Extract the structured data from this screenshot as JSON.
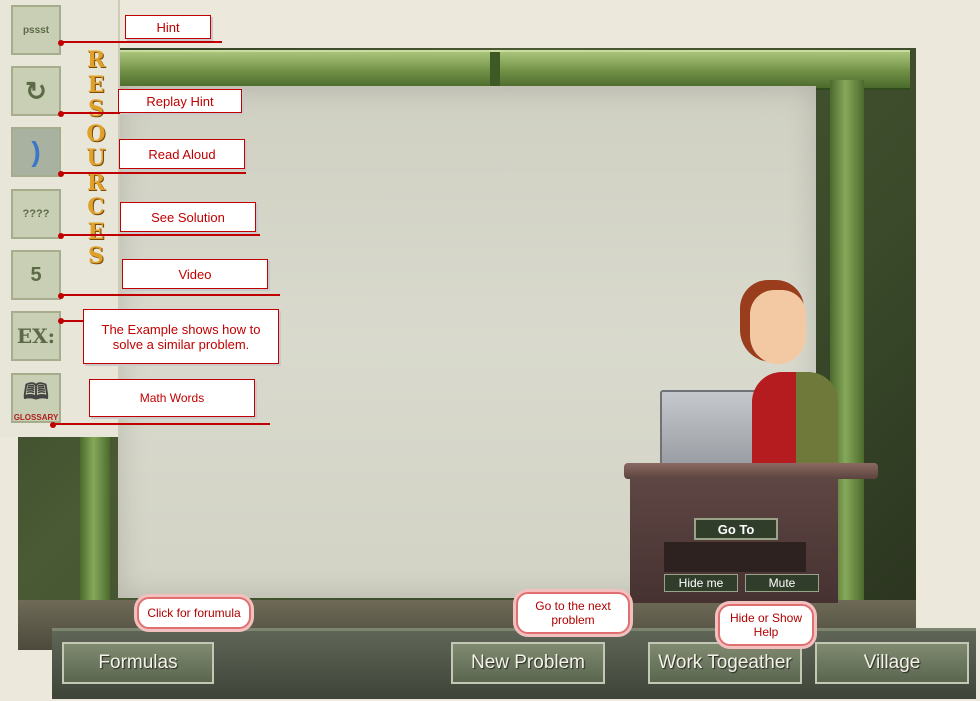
{
  "sidebar": {
    "title": "RESOURCES",
    "tiles": [
      {
        "name": "hint-tile",
        "glyph": "pssst"
      },
      {
        "name": "replay-hint-tile",
        "glyph": "↻"
      },
      {
        "name": "read-aloud-tile",
        "glyph": ")"
      },
      {
        "name": "see-solution-tile",
        "glyph": "????"
      },
      {
        "name": "video-tile",
        "glyph": "5"
      },
      {
        "name": "example-tile",
        "glyph": "EX:"
      },
      {
        "name": "glossary-tile",
        "glyph": "GLOSSARY"
      }
    ]
  },
  "callouts": {
    "hint": "Hint",
    "replay_hint": "Replay Hint",
    "read_aloud": "Read Aloud",
    "see_solution": "See Solution",
    "video": "Video",
    "example": "The Example shows how to solve a similar problem.",
    "math_words": "Math Words"
  },
  "bubbles": {
    "formulas_help": "Click for forumula",
    "new_problem_help": "Go to the next problem",
    "work_together_help": "Hide or Show Help"
  },
  "desk": {
    "go_to": "Go To",
    "hide_me": "Hide me",
    "mute": "Mute"
  },
  "nav": {
    "formulas": "Formulas",
    "new_problem": "New Problem",
    "work_together": "Work Togeather",
    "village": "Village"
  }
}
